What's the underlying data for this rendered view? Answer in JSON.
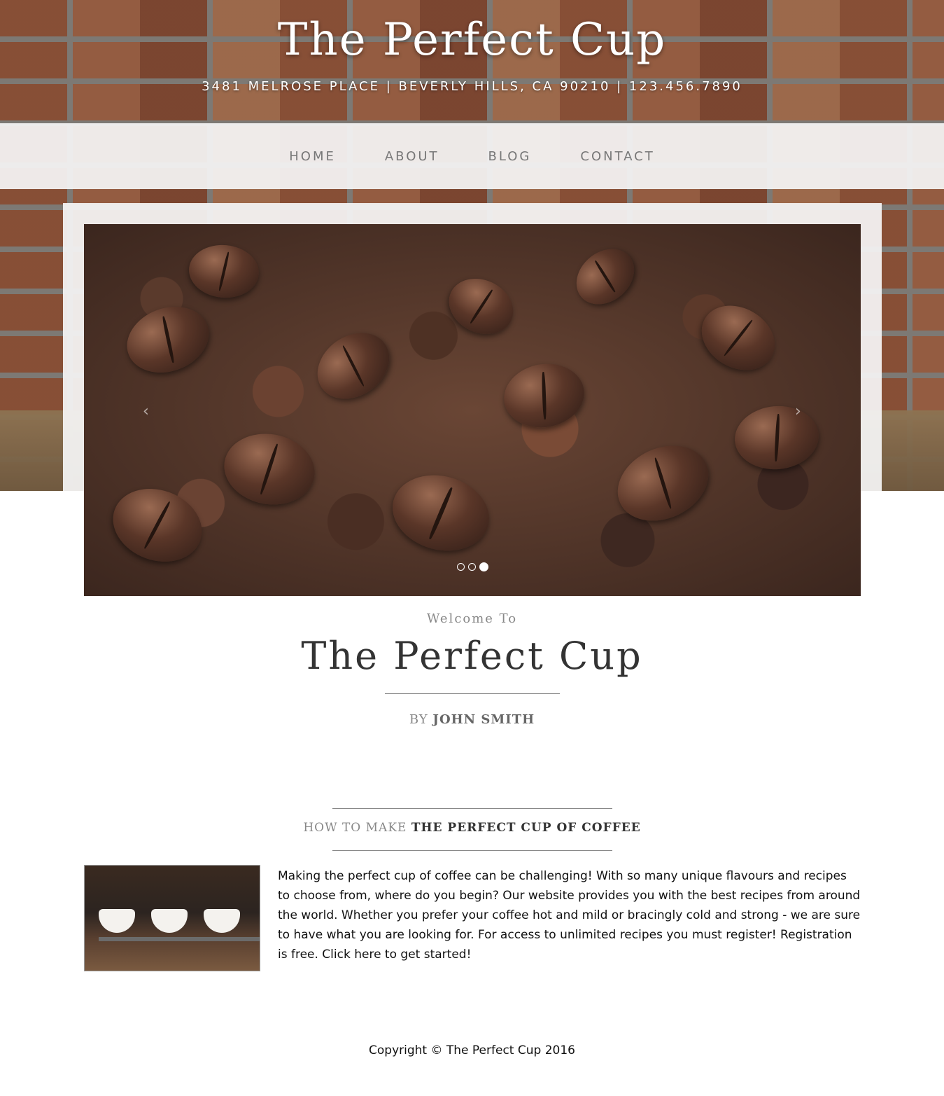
{
  "header": {
    "site_title": "The Perfect Cup",
    "address": "3481 MELROSE PLACE | BEVERLY HILLS, CA 90210 | 123.456.7890"
  },
  "nav": {
    "items": [
      {
        "label": "HOME"
      },
      {
        "label": "ABOUT"
      },
      {
        "label": "BLOG"
      },
      {
        "label": "CONTACT"
      }
    ]
  },
  "slider": {
    "prev_label": "‹",
    "next_label": "›",
    "slide_count": 3,
    "active_slide": 3
  },
  "intro": {
    "welcome": "Welcome To",
    "title": "The Perfect Cup",
    "by_label": "BY",
    "author": "JOHN SMITH"
  },
  "section": {
    "heading_light": "HOW TO MAKE",
    "heading_strong": "THE PERFECT CUP OF COFFEE",
    "body": "Making the perfect cup of coffee can be challenging! With so many unique flavours and recipes to choose from, where do you begin? Our website provides you with the best recipes from around the world. Whether you prefer your coffee hot and mild or bracingly cold and strong - we are sure to have what you are looking for. For access to unlimited recipes you must register! Registration is free. Click here to get started!"
  },
  "footer": {
    "copyright": "Copyright © The Perfect Cup 2016"
  },
  "colors": {
    "text_dark": "#333333",
    "text_muted": "#888888",
    "nav_text": "#777777",
    "panel": "#f5f5f5"
  }
}
